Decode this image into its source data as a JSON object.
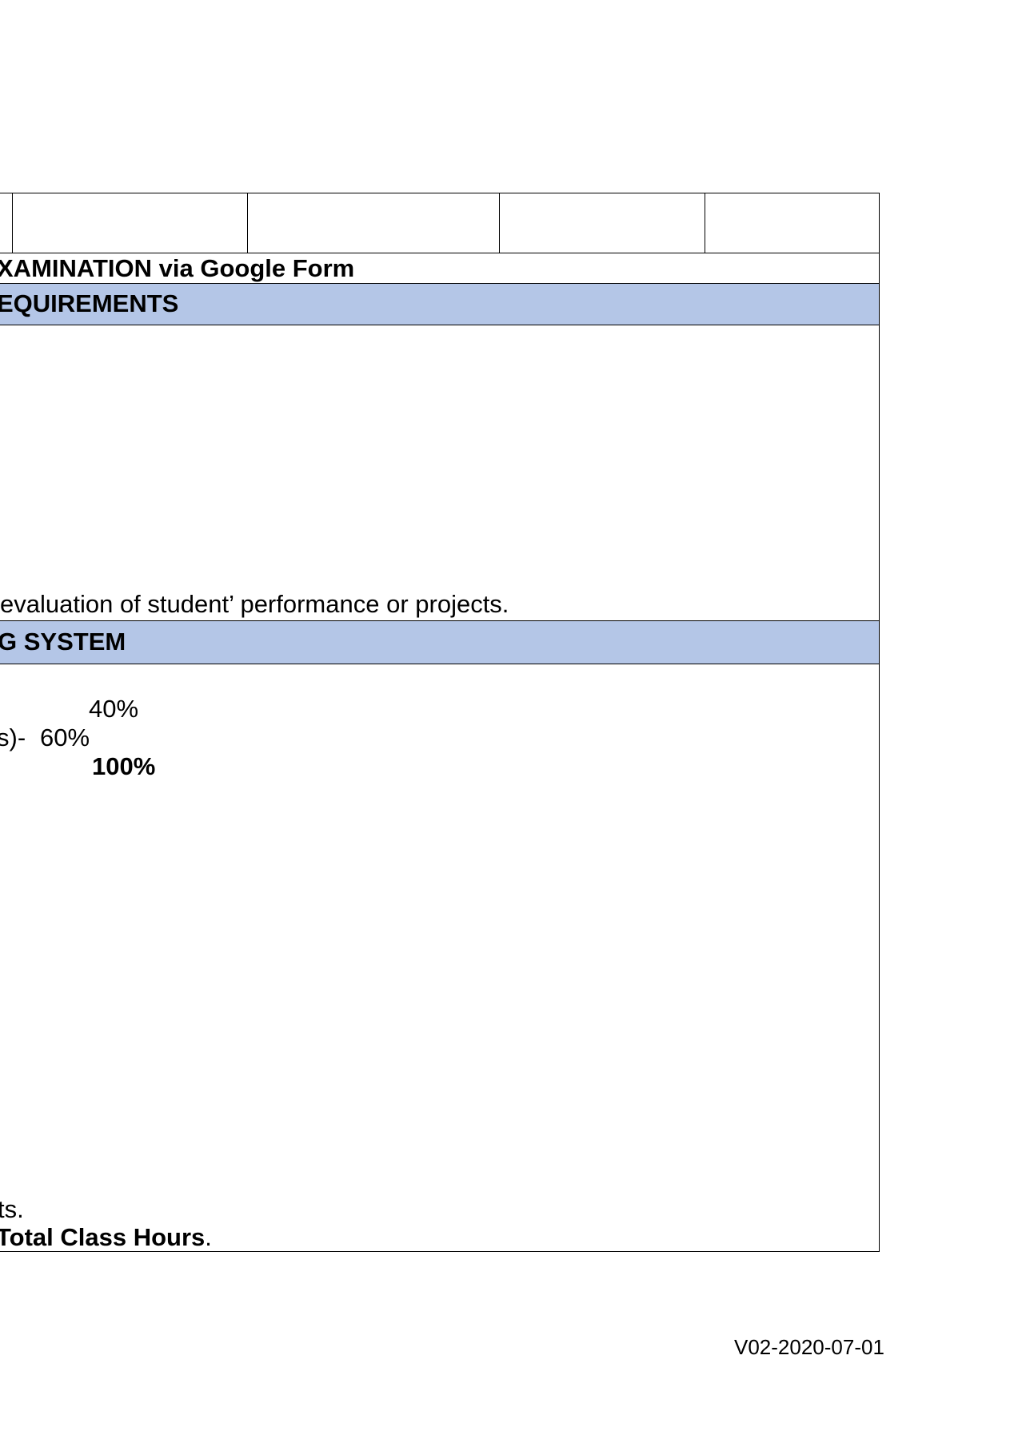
{
  "exam_row": {
    "text": "XAMINATION via Google Form"
  },
  "requirements": {
    "header": "EQUIREMENTS",
    "body_line": "evaluation of student’ performance or projects."
  },
  "grading": {
    "header": "G SYSTEM",
    "line1_value": "40%",
    "line2_prefix": "s)-",
    "line2_value": "60%",
    "total_value": "100%",
    "note1": "ts.",
    "note2_bold": "Total Class Hours",
    "note2_tail": "."
  },
  "footer": {
    "version": "V02-2020-07-01"
  }
}
